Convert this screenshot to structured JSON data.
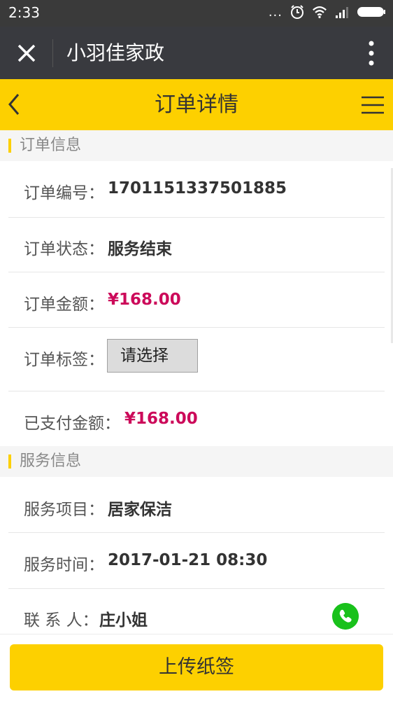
{
  "status_bar": {
    "time": "2:33",
    "dots": "..."
  },
  "wechat_bar": {
    "title": "小羽佳家政"
  },
  "header": {
    "title": "订单详情"
  },
  "order_section": {
    "title": "订单信息",
    "order_no_label": "订单编号：",
    "order_no": "1701151337501885",
    "status_label": "订单状态：",
    "status": "服务结束",
    "amount_label": "订单金额：",
    "amount": "¥168.00",
    "tag_label": "订单标签：",
    "tag_select": "请选择",
    "paid_label": "已支付金额：",
    "paid": "¥168.00"
  },
  "service_section": {
    "title": "服务信息",
    "item_label": "服务项目：",
    "item": "居家保洁",
    "time_label": "服务时间：",
    "time": "2017-01-21 08:30",
    "contact_label": "联 系 人：",
    "contact": "庄小姐"
  },
  "footer": {
    "upload_label": "上传纸签"
  },
  "colors": {
    "accent": "#fdd000",
    "price": "#cc0a5a",
    "phone": "#19c11b",
    "wechat_bar": "#393a3f"
  }
}
